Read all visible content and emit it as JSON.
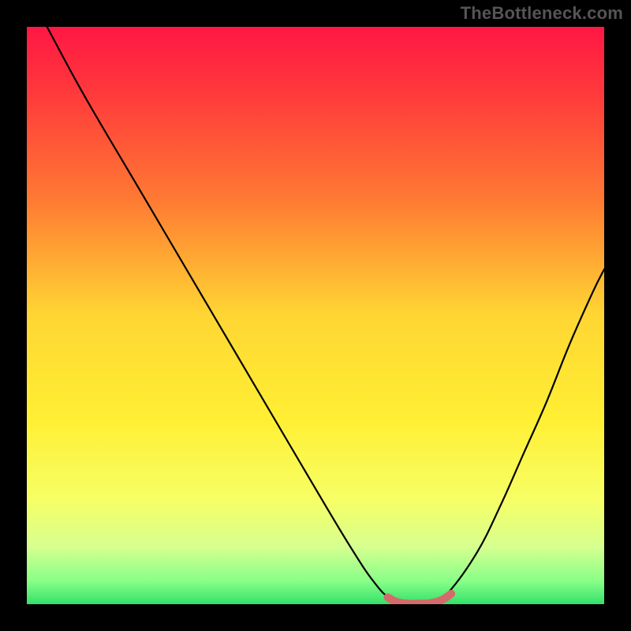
{
  "watermark": "TheBottleneck.com",
  "chart_data": {
    "type": "line",
    "title": "",
    "xlabel": "",
    "ylabel": "",
    "xlim": [
      0,
      100
    ],
    "ylim": [
      0,
      100
    ],
    "grid": false,
    "series": [
      {
        "name": "curve",
        "color": "#000000",
        "x": [
          3.5,
          10,
          20,
          30,
          40,
          50,
          56,
          60,
          63,
          67,
          70,
          73,
          78,
          82,
          86,
          90,
          94,
          98,
          100
        ],
        "values": [
          100,
          88,
          71,
          54,
          37,
          20,
          10,
          4,
          1,
          0,
          0,
          2,
          9,
          17,
          26,
          35,
          45,
          54,
          58
        ]
      }
    ],
    "highlight": {
      "name": "flat-bottom",
      "color": "#d46a6a",
      "x": [
        62.5,
        64,
        66,
        68,
        70,
        72,
        73.5
      ],
      "values": [
        1.2,
        0.4,
        0.1,
        0.1,
        0.2,
        0.8,
        1.8
      ]
    },
    "background": {
      "type": "vertical-gradient",
      "stops": [
        {
          "offset": 0.0,
          "color": "#ff1744"
        },
        {
          "offset": 0.12,
          "color": "#ff3b3b"
        },
        {
          "offset": 0.3,
          "color": "#ff7a33"
        },
        {
          "offset": 0.5,
          "color": "#ffd633"
        },
        {
          "offset": 0.68,
          "color": "#ffef33"
        },
        {
          "offset": 0.82,
          "color": "#f6ff66"
        },
        {
          "offset": 0.9,
          "color": "#d7ff8f"
        },
        {
          "offset": 0.96,
          "color": "#88ff88"
        },
        {
          "offset": 1.0,
          "color": "#33e06b"
        }
      ]
    }
  }
}
